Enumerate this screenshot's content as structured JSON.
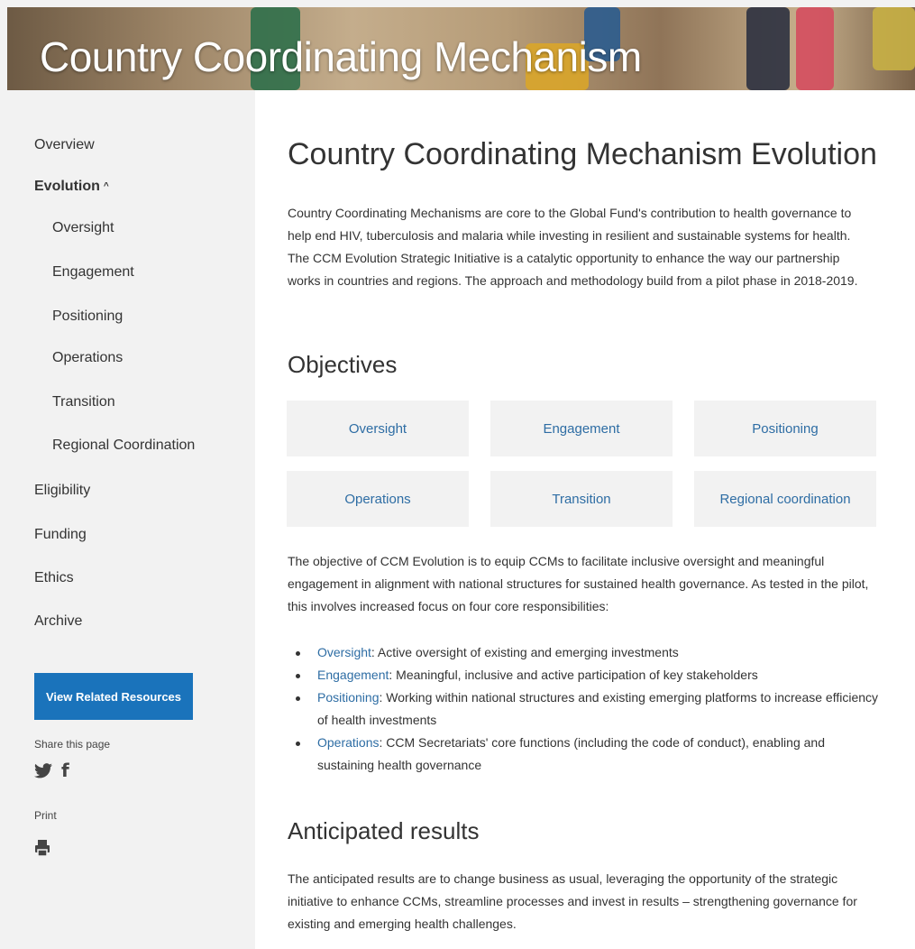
{
  "hero": {
    "title": "Country Coordinating Mechanism"
  },
  "sidebar": {
    "items": [
      {
        "label": "Overview"
      },
      {
        "label": "Evolution",
        "chevron": "^"
      },
      {
        "label": "Oversight"
      },
      {
        "label": "Engagement"
      },
      {
        "label": "Positioning"
      },
      {
        "label": "Operations"
      },
      {
        "label": "Transition"
      },
      {
        "label": "Regional Coordination"
      },
      {
        "label": "Eligibility"
      },
      {
        "label": "Funding"
      },
      {
        "label": "Ethics"
      },
      {
        "label": "Archive"
      }
    ],
    "related_button": "View Related Resources",
    "share_label": "Share this page",
    "print_label": "Print",
    "icons": [
      "twitter-icon",
      "facebook-icon",
      "print-icon"
    ]
  },
  "main": {
    "title": "Country Coordinating Mechanism Evolution",
    "intro": "Country Coordinating Mechanisms are core to the Global Fund's contribution to health governance to help end HIV, tuberculosis and malaria while investing in resilient and sustainable systems for health. The CCM Evolution Strategic Initiative is a catalytic opportunity to enhance the way our partnership works in countries and regions. The approach and methodology build from a pilot phase in 2018-2019.",
    "objectives_heading": "Objectives",
    "tiles": [
      "Oversight",
      "Engagement",
      "Positioning",
      "Operations",
      "Transition",
      "Regional coordination"
    ],
    "objective_text": "The objective of CCM Evolution is to equip CCMs to facilitate inclusive oversight and meaningful engagement in alignment with national structures for sustained health governance. As tested in the pilot, this involves increased focus on four core responsibilities:",
    "bullets": [
      {
        "link": "Oversight",
        "text": ": Active oversight of existing and emerging investments"
      },
      {
        "link": "Engagement",
        "text": ": Meaningful, inclusive and active participation of key stakeholders"
      },
      {
        "link": "Positioning",
        "text": ": Working within national structures and existing emerging platforms to increase efficiency of health investments"
      },
      {
        "link": "Operations",
        "text": ": CCM Secretariats' core functions (including the code of conduct), enabling and sustaining health governance"
      }
    ],
    "results_heading": "Anticipated results",
    "results_text": "The anticipated results are to change business as usual, leveraging the opportunity of the strategic initiative to enhance CCMs, streamline processes and invest in results – strengthening governance for existing and emerging health challenges."
  },
  "colors": {
    "accent": "#1a73bb",
    "link": "#2e6da4",
    "sidebar_bg": "#f2f2f2"
  }
}
